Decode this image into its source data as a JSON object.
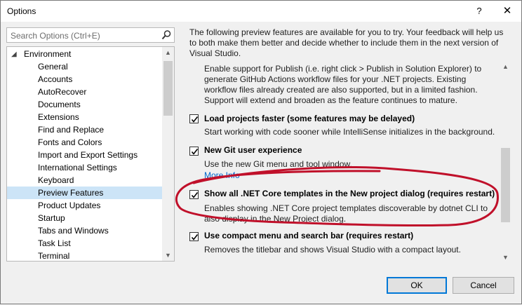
{
  "window": {
    "title": "Options",
    "help_glyph": "?",
    "close_glyph": "✕"
  },
  "search": {
    "placeholder": "Search Options (Ctrl+E)"
  },
  "tree": {
    "root": "Environment",
    "items": [
      {
        "label": "General"
      },
      {
        "label": "Accounts"
      },
      {
        "label": "AutoRecover"
      },
      {
        "label": "Documents"
      },
      {
        "label": "Extensions"
      },
      {
        "label": "Find and Replace"
      },
      {
        "label": "Fonts and Colors"
      },
      {
        "label": "Import and Export Settings"
      },
      {
        "label": "International Settings"
      },
      {
        "label": "Keyboard"
      },
      {
        "label": "Preview Features",
        "selected": true
      },
      {
        "label": "Product Updates"
      },
      {
        "label": "Startup"
      },
      {
        "label": "Tabs and Windows"
      },
      {
        "label": "Task List"
      },
      {
        "label": "Terminal"
      }
    ]
  },
  "intro": "The following preview features are available for you to try. Your feedback will help us to both make them better and decide whether to include them in the next version of Visual Studio.",
  "options": {
    "publish_desc": [
      "Enable support for Publish (i.e. right click > Publish in Solution Explorer) to",
      "generate GitHub Actions workflow files for your .NET projects. Existing",
      "workflow files already created are also supported, but in a limited fashion.",
      "Support will extend and broaden as the feature continues to mature."
    ],
    "load_faster": {
      "label": "Load projects faster (some features may be delayed)",
      "desc": "Start working with code sooner while IntelliSense initializes in the background.",
      "checked": true
    },
    "git": {
      "label": "New Git user experience",
      "desc": "Use the new Git menu and tool window.",
      "link": "More Info",
      "checked": true
    },
    "net_core": {
      "label": "Show all .NET Core templates in the New project dialog (requires restart)",
      "desc": [
        "Enables showing .NET Core project templates discoverable by dotnet CLI to",
        "also display in the New Project dialog."
      ],
      "checked": true
    },
    "compact": {
      "label": "Use compact menu and search bar (requires restart)",
      "desc": "Removes the titlebar and shows Visual Studio with a compact layout.",
      "checked": true
    }
  },
  "buttons": {
    "ok": "OK",
    "cancel": "Cancel"
  },
  "colors": {
    "selection": "#cce4f7",
    "link": "#0066cc",
    "annotation": "#c0102a",
    "default_button_border": "#0078d7"
  }
}
